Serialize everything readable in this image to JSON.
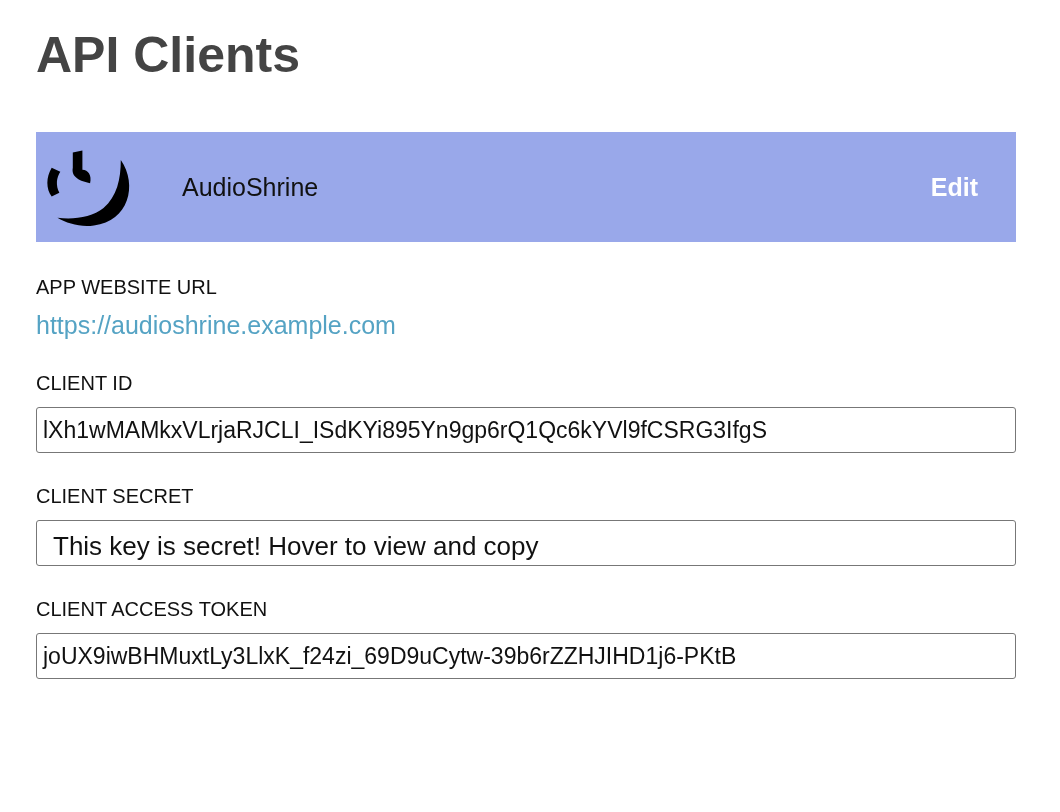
{
  "page": {
    "title": "API Clients"
  },
  "client": {
    "name": "AudioShrine",
    "edit_label": "Edit"
  },
  "fields": [
    {
      "kind": "link",
      "label": "APP WEBSITE URL",
      "value": "https://audioshrine.example.com"
    },
    {
      "kind": "input",
      "label": "CLIENT ID",
      "value": "lXh1wMAMkxVLrjaRJCLI_ISdKYi895Yn9gp6rQ1Qc6kYVl9fCSRG3IfgS"
    },
    {
      "kind": "input",
      "label": "CLIENT SECRET",
      "value": "This key is secret! Hover to view and copy"
    },
    {
      "kind": "input",
      "label": "CLIENT ACCESS TOKEN",
      "value": "joUX9iwBHMuxtLy3LlxK_f24zi_69D9uCytw-39b6rZZHJIHD1j6-PKtB"
    }
  ]
}
